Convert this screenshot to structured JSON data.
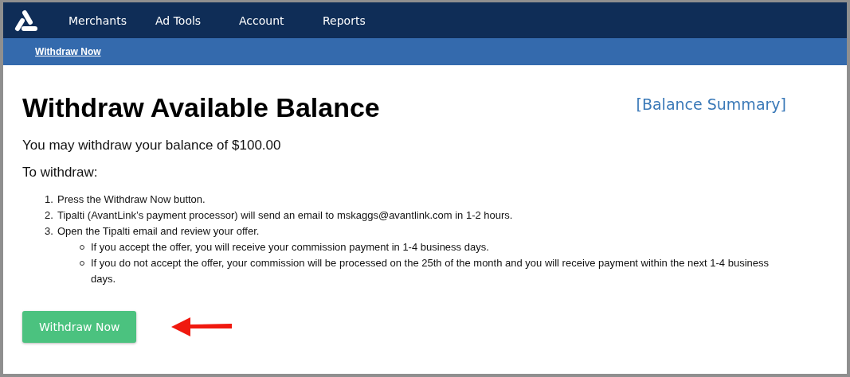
{
  "nav": {
    "items": [
      "Merchants",
      "Ad Tools",
      "Account",
      "Reports"
    ]
  },
  "subnav": {
    "links": [
      "Withdraw Now"
    ]
  },
  "title": "Withdraw Available Balance",
  "summary_link": "[Balance Summary]",
  "balance_text": "You may withdraw your balance of $100.00",
  "instructions_heading": "To withdraw:",
  "steps": [
    {
      "number": "1.",
      "text": "Press the Withdraw Now button."
    },
    {
      "number": "2.",
      "text": "Tipalti (AvantLink’s payment processor) will send an email to mskaggs@avantlink.com in 1-2 hours."
    },
    {
      "number": "3.",
      "text": "Open the Tipalti email and review your offer.",
      "children": [
        "If you accept the offer, you will receive your commission payment in 1-4 business days.",
        "If you do not accept the offer, your commission will be processed on the 25th of the month and you will receive payment within the next 1-4 business days."
      ]
    }
  ],
  "withdraw_button": "Withdraw Now"
}
